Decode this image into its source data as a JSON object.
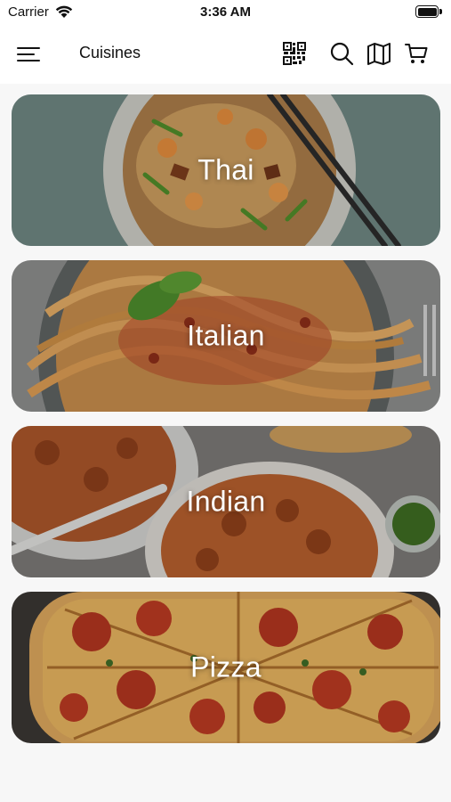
{
  "status_bar": {
    "carrier": "Carrier",
    "time": "3:36 AM"
  },
  "header": {
    "title": "Cuisines",
    "icons": [
      "menu-icon",
      "qr-code-icon",
      "search-icon",
      "map-icon",
      "cart-icon"
    ]
  },
  "cuisines": [
    {
      "label": "Thai"
    },
    {
      "label": "Italian"
    },
    {
      "label": "Indian"
    },
    {
      "label": "Pizza"
    }
  ]
}
